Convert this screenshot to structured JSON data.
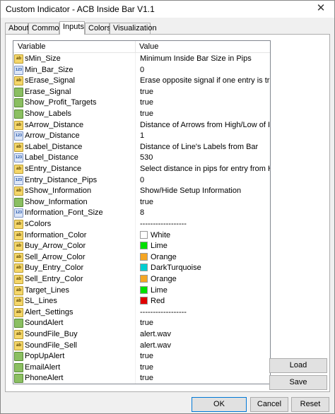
{
  "window": {
    "title": "Custom Indicator - ACB Inside Bar V1.1",
    "close_glyph": "✕"
  },
  "tabs": [
    {
      "label": "About"
    },
    {
      "label": "Common"
    },
    {
      "label": "Inputs",
      "active": true
    },
    {
      "label": "Colors"
    },
    {
      "label": "Visualization"
    }
  ],
  "grid": {
    "col_variable": "Variable",
    "col_value": "Value",
    "rows": [
      {
        "type": "ab",
        "variable": "sMin_Size",
        "value": "Minimum Inside Bar Size in Pips"
      },
      {
        "type": "num",
        "variable": "Min_Bar_Size",
        "value": "0"
      },
      {
        "type": "ab",
        "variable": "sErase_Signal",
        "value": "Erase opposite signal if one entry is triggered"
      },
      {
        "type": "bool",
        "variable": "Erase_Signal",
        "value": "true"
      },
      {
        "type": "bool",
        "variable": "Show_Profit_Targets",
        "value": "true"
      },
      {
        "type": "bool",
        "variable": "Show_Labels",
        "value": "true"
      },
      {
        "type": "ab",
        "variable": "sArrow_Distance",
        "value": "Distance of Arrows from High/Low of Inside ..."
      },
      {
        "type": "num",
        "variable": "Arrow_Distance",
        "value": "1"
      },
      {
        "type": "ab",
        "variable": "sLabel_Distance",
        "value": "Distance of Line's Labels from Bar"
      },
      {
        "type": "num",
        "variable": "Label_Distance",
        "value": "530"
      },
      {
        "type": "ab",
        "variable": "sEntry_Distance",
        "value": "Select distance in pips for entry from High/L..."
      },
      {
        "type": "num",
        "variable": "Entry_Distance_Pips",
        "value": "0"
      },
      {
        "type": "ab",
        "variable": "sShow_Information",
        "value": "Show/Hide Setup Information"
      },
      {
        "type": "bool",
        "variable": "Show_Information",
        "value": "true"
      },
      {
        "type": "num",
        "variable": "Information_Font_Size",
        "value": "8"
      },
      {
        "type": "ab",
        "variable": "sColors",
        "value": "------------------"
      },
      {
        "type": "clr",
        "variable": "Information_Color",
        "value": "White",
        "color": "#ffffff"
      },
      {
        "type": "clr",
        "variable": "Buy_Arrow_Color",
        "value": "Lime",
        "color": "#00e000"
      },
      {
        "type": "clr",
        "variable": "Sell_Arrow_Color",
        "value": "Orange",
        "color": "#f5a623"
      },
      {
        "type": "clr",
        "variable": "Buy_Entry_Color",
        "value": "DarkTurquoise",
        "color": "#00ced1"
      },
      {
        "type": "clr",
        "variable": "Sell_Entry_Color",
        "value": "Orange",
        "color": "#f5a623"
      },
      {
        "type": "clr",
        "variable": "Target_Lines",
        "value": "Lime",
        "color": "#00e000"
      },
      {
        "type": "clr",
        "variable": "SL_Lines",
        "value": "Red",
        "color": "#e00000"
      },
      {
        "type": "ab",
        "variable": "Alert_Settings",
        "value": "------------------"
      },
      {
        "type": "bool",
        "variable": "SoundAlert",
        "value": "true"
      },
      {
        "type": "ab",
        "variable": "SoundFile_Buy",
        "value": "alert.wav"
      },
      {
        "type": "ab",
        "variable": "SoundFile_Sell",
        "value": "alert.wav"
      },
      {
        "type": "bool",
        "variable": "PopUpAlert",
        "value": "true"
      },
      {
        "type": "bool",
        "variable": "EmailAlert",
        "value": "true"
      },
      {
        "type": "bool",
        "variable": "PhoneAlert",
        "value": "true"
      }
    ]
  },
  "icons": {
    "ab": "ab",
    "num": "123",
    "bool": "",
    "clr": "ab"
  },
  "buttons": {
    "load": "Load",
    "save": "Save",
    "ok": "OK",
    "cancel": "Cancel",
    "reset": "Reset"
  }
}
